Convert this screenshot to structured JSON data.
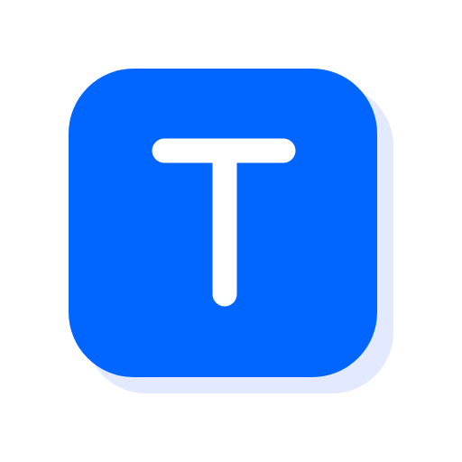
{
  "icon": {
    "name": "text-tool-icon",
    "glyph": "T",
    "colors": {
      "background": "#ffffff",
      "tile": "#0066ff",
      "tile_shadow": "#e3e9ff",
      "glyph": "#ffffff"
    }
  }
}
